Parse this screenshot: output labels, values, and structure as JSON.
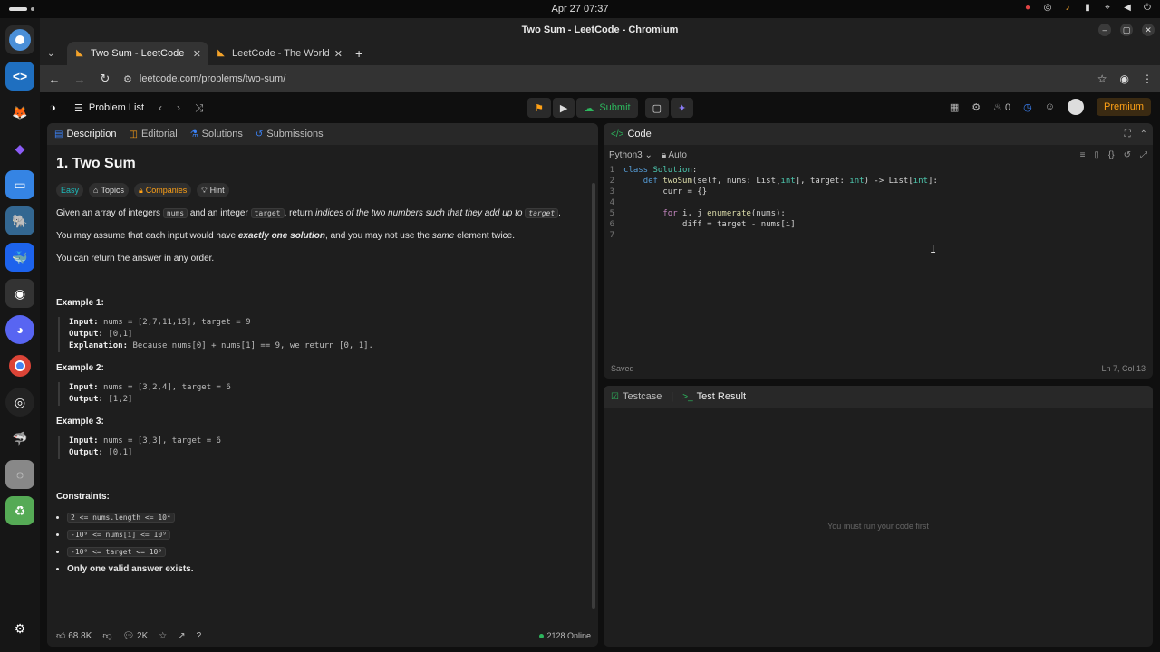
{
  "system": {
    "clock": "Apr 27  07:37"
  },
  "window": {
    "title": "Two Sum - LeetCode - Chromium"
  },
  "tabs": [
    {
      "label": "Two Sum - LeetCode",
      "active": true
    },
    {
      "label": "LeetCode - The World's I",
      "active": false
    }
  ],
  "omnibox": {
    "url": "leetcode.com/problems/two-sum/"
  },
  "lcnav": {
    "problem_list": "Problem List",
    "submit": "Submit",
    "streak": "0",
    "premium": "Premium"
  },
  "left": {
    "tabs": [
      "Description",
      "Editorial",
      "Solutions",
      "Submissions"
    ],
    "title": "1. Two Sum",
    "tags": [
      "Easy",
      "Topics",
      "Companies",
      "Hint"
    ],
    "para1_a": "Given an array of integers ",
    "para1_code1": "nums",
    "para1_b": " and an integer ",
    "para1_code2": "target",
    "para1_c": ", return ",
    "para1_em": "indices of the two numbers such that they add up to",
    "para1_code3": "target",
    "para1_d": ".",
    "para2_a": "You may assume that each input would have ",
    "para2_strong": "exactly one solution",
    "para2_b": ", and you may not use the ",
    "para2_em": "same",
    "para2_c": " element twice.",
    "para3": "You can return the answer in any order.",
    "examples": [
      {
        "title": "Example 1:",
        "input": "nums = [2,7,11,15], target = 9",
        "output": "[0,1]",
        "explanation": "Because nums[0] + nums[1] == 9, we return [0, 1]."
      },
      {
        "title": "Example 2:",
        "input": "nums = [3,2,4], target = 6",
        "output": "[1,2]"
      },
      {
        "title": "Example 3:",
        "input": "nums = [3,3], target = 6",
        "output": "[0,1]"
      }
    ],
    "labels": {
      "input": "Input:",
      "output": "Output:",
      "explanation": "Explanation:"
    },
    "constraints_title": "Constraints:",
    "constraints": [
      "2 <= nums.length <= 10⁴",
      "-10⁹ <= nums[i] <= 10⁹",
      "-10⁹ <= target <= 10⁹"
    ],
    "constraint_last": "Only one valid answer exists.",
    "footer": {
      "likes": "68.8K",
      "comments": "2K",
      "online": "2128 Online"
    }
  },
  "code": {
    "title": "Code",
    "language": "Python3",
    "auto": "Auto",
    "lines": [
      "class Solution:",
      "    def twoSum(self, nums: List[int], target: int) -> List[int]:",
      "        curr = {}",
      "",
      "        for i, j enumerate(nums):",
      "            diff = target - nums[i]",
      ""
    ],
    "status_saved": "Saved",
    "status_pos": "Ln 7, Col 13"
  },
  "testpanel": {
    "tab_testcase": "Testcase",
    "tab_result": "Test Result",
    "empty": "You must run your code first"
  },
  "colors": {
    "accent_green": "#2db55d",
    "brand_orange": "#ffa116",
    "easy_teal": "#1cbaba"
  }
}
